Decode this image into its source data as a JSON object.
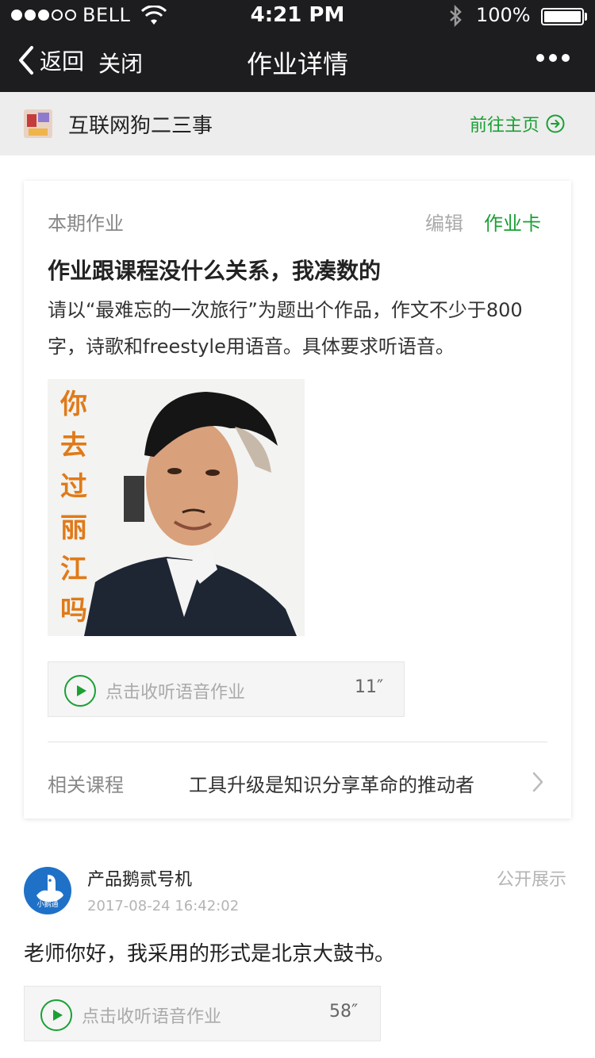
{
  "status_bar": {
    "carrier": "BELL",
    "time": "4:21 PM",
    "battery": "100%"
  },
  "nav": {
    "back_label": "返回",
    "close_label": "关闭",
    "title": "作业详情"
  },
  "author": {
    "name": "互联网狗二三事",
    "home_link": "前往主页"
  },
  "homework": {
    "section_label": "本期作业",
    "edit_label": "编辑",
    "card_label": "作业卡",
    "title": "作业跟课程没什么关系，我凑数的",
    "description": "请以“最难忘的一次旅行”为题出个作品，作文不少于800字，诗歌和freestyle用语音。具体要求听语音。",
    "image_caption": "你去过丽江吗",
    "audio": {
      "label": "点击收听语音作业",
      "duration": "11″"
    },
    "related_label": "相关课程",
    "related_course": "工具升级是知识分享革命的推动者"
  },
  "submission": {
    "user": "产品鹅贰号机",
    "avatar_text": "小鹅通",
    "time": "2017-08-24 16:42:02",
    "public_label": "公开展示",
    "content": "老师你好，我采用的形式是北京大鼓书。",
    "audio": {
      "label": "点击收听语音作业",
      "duration": "58″"
    }
  },
  "colors": {
    "accent_green": "#1aa034",
    "topbar_bg": "#1d1d1f",
    "meme_orange": "#e07a18",
    "avatar_blue": "#1f71c8"
  }
}
